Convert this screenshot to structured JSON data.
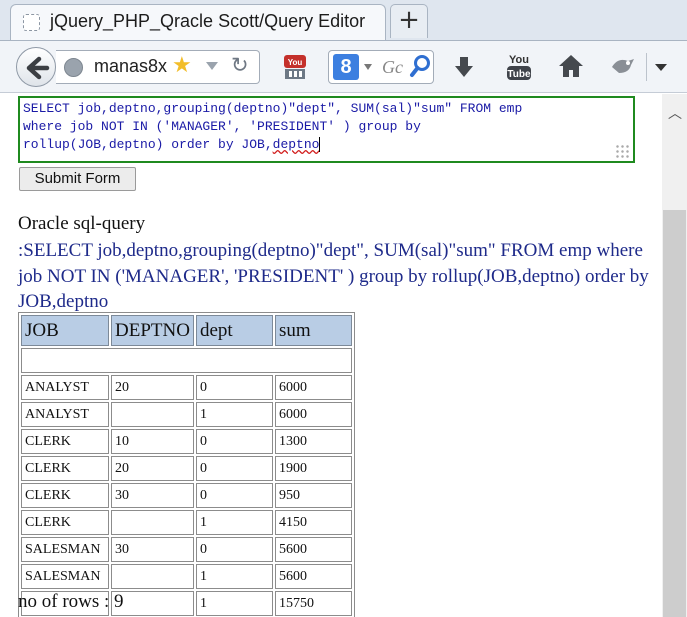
{
  "tab": {
    "title": "jQuery_PHP_Qracle Scott/Query Editor",
    "new_tab_label": "+"
  },
  "navbar": {
    "url_text": "manas8x",
    "search_placeholder": "Gc",
    "search_engine_letter": "8"
  },
  "editor": {
    "query_lines": [
      "SELECT job,deptno,grouping(deptno)\"dept\", SUM(sal)\"sum\" FROM emp",
      "where job NOT IN ('MANAGER', 'PRESIDENT' ) group by",
      "rollup(JOB,deptno) order by JOB,"
    ],
    "query_last_word": "deptno"
  },
  "submit_label": "Submit Form",
  "result": {
    "label": "Oracle sql-query",
    "echo": ":SELECT job,deptno,grouping(deptno)\"dept\", SUM(sal)\"sum\" FROM emp where job NOT IN ('MANAGER', 'PRESIDENT' ) group by rollup(JOB,deptno) order by JOB,deptno",
    "columns": [
      "JOB",
      "DEPTNO",
      "dept",
      "sum"
    ],
    "rows": [
      [
        "ANALYST",
        "20",
        "0",
        "6000"
      ],
      [
        "ANALYST",
        "",
        "1",
        "6000"
      ],
      [
        "CLERK",
        "10",
        "0",
        "1300"
      ],
      [
        "CLERK",
        "20",
        "0",
        "1900"
      ],
      [
        "CLERK",
        "30",
        "0",
        "950"
      ],
      [
        "CLERK",
        "",
        "1",
        "4150"
      ],
      [
        "SALESMAN",
        "30",
        "0",
        "5600"
      ],
      [
        "SALESMAN",
        "",
        "1",
        "5600"
      ],
      [
        "",
        "",
        "1",
        "15750"
      ]
    ],
    "row_count": "no of rows : 9"
  },
  "icons": {
    "tab_favicon": "page-icon",
    "back": "back-arrow-icon",
    "identity": "globe-icon",
    "bookmark": "star-icon",
    "history_dropdown": "dropdown-triangle-icon",
    "reload": "reload-icon",
    "youtube_downloader": "youtube-download-icon",
    "search_engine": "google-icon",
    "search_go": "magnifier-icon",
    "downloads": "download-arrow-icon",
    "youtube": "youtube-icon",
    "home": "home-icon",
    "addon": "addon-icon",
    "menu": "menu-triangle-icon",
    "scroll_up": "scroll-up-arrow-icon",
    "resize_grip": "resize-grip-icon"
  },
  "colors": {
    "editor_border": "#1f8a1f",
    "editor_text": "#1a1aa6",
    "echo_text": "#1e2a8a",
    "table_header_bg": "#b9cde5"
  }
}
